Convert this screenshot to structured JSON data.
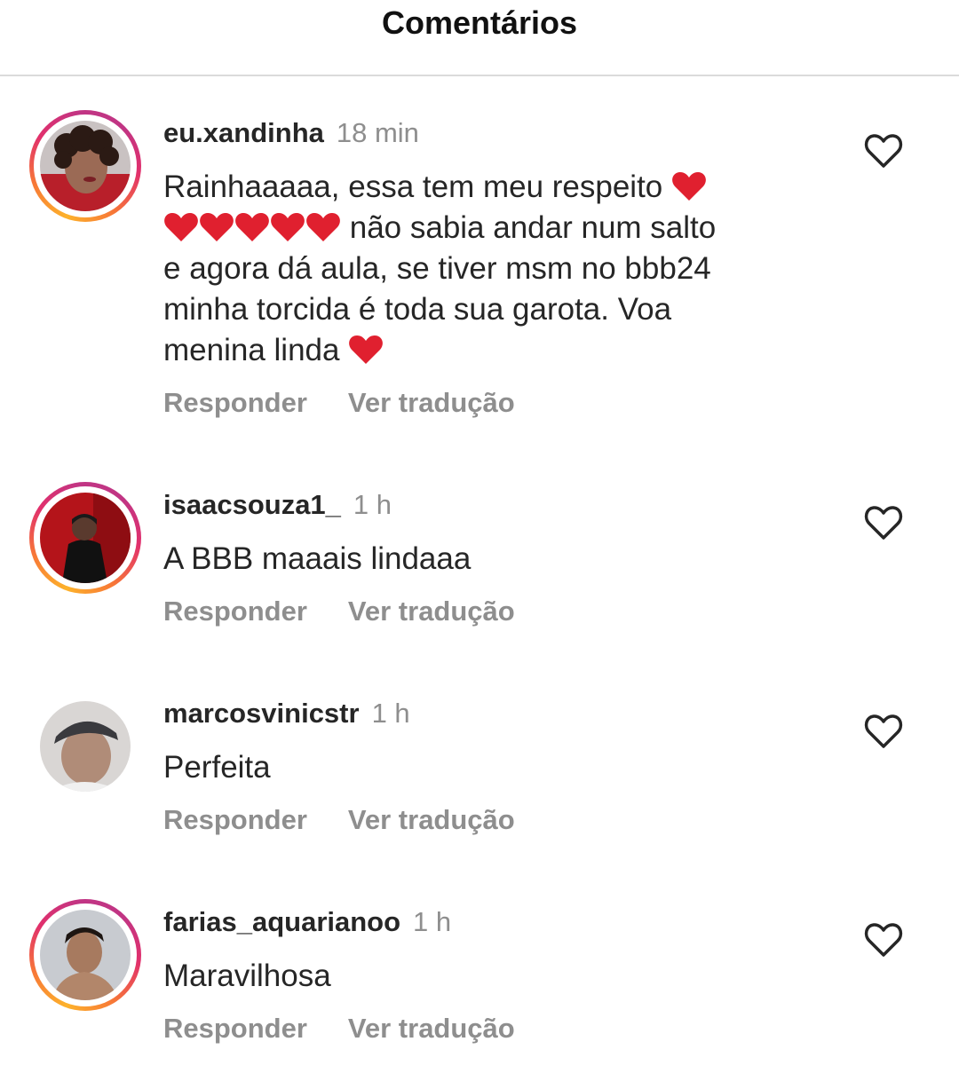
{
  "header": {
    "title": "Comentários"
  },
  "comments": [
    {
      "username": "eu.xandinha",
      "time": "18 min",
      "line1": "Rainhaaaaa, essa tem meu respeito",
      "line2": "não sabia andar num salto",
      "line3": "e agora dá aula, se tiver msm no bbb24",
      "line4": "minha torcida é toda sua garota. Voa",
      "line5": "menina linda",
      "reply": "Responder",
      "translate": "Ver tradução"
    },
    {
      "username": "isaacsouza1_",
      "time": "1 h",
      "text": "A BBB maaais lindaaa",
      "reply": "Responder",
      "translate": "Ver tradução"
    },
    {
      "username": "marcosvinicstr",
      "time": "1 h",
      "text": "Perfeita",
      "reply": "Responder",
      "translate": "Ver tradução"
    },
    {
      "username": "farias_aquarianoo",
      "time": "1 h",
      "text": "Maravilhosa",
      "reply": "Responder",
      "translate": "Ver tradução"
    }
  ],
  "icons": {
    "like": "heart-outline-icon",
    "emoji": "red-heart-emoji"
  },
  "colors": {
    "text": "#262626",
    "muted": "#8e8e8e",
    "divider": "#dbdbdb",
    "heart_emoji": "#e0202f"
  }
}
